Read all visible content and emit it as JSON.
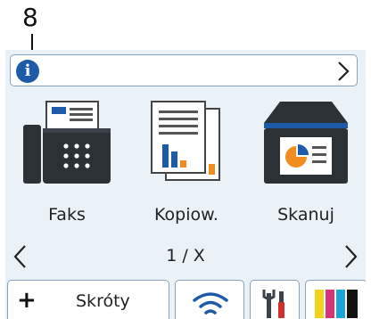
{
  "callout": {
    "number": "8"
  },
  "info_bar": {
    "icon": "info-icon",
    "chevron": "chevron-right-icon"
  },
  "apps": [
    {
      "label": "Faks",
      "icon": "fax-icon"
    },
    {
      "label": "Kopiow.",
      "icon": "copy-icon"
    },
    {
      "label": "Skanuj",
      "icon": "scan-icon"
    }
  ],
  "pager": {
    "text": "1 / X"
  },
  "tabs": {
    "shortcuts": {
      "label": "Skróty",
      "icon": "plus-icon"
    },
    "wifi": {
      "icon": "wifi-icon"
    },
    "settings": {
      "icon": "tools-icon"
    },
    "toner": {
      "icon": "toner-icon"
    }
  },
  "colors": {
    "accent_blue": "#1d5aa8",
    "orange": "#f28c1e",
    "screen_bg": "#eaf2f8"
  }
}
